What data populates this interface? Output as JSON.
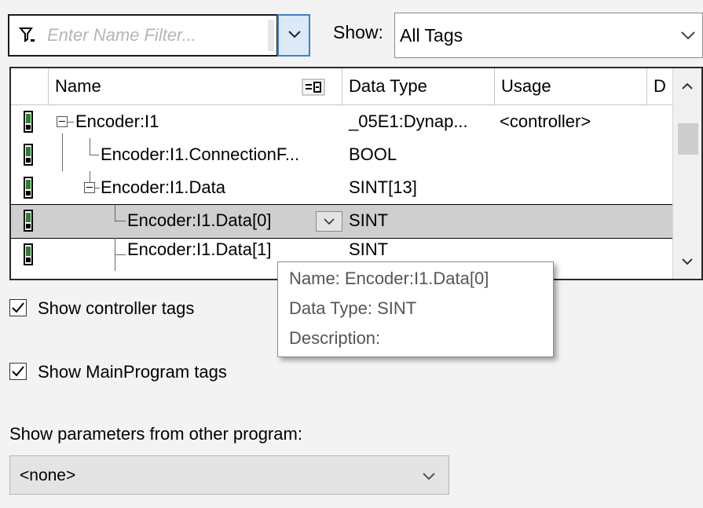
{
  "filter": {
    "placeholder": "Enter Name Filter...",
    "value": ""
  },
  "show": {
    "label": "Show:",
    "value": "All Tags"
  },
  "grid": {
    "columns": {
      "name": "Name",
      "data_type": "Data Type",
      "usage": "Usage",
      "description": "D"
    },
    "rows": [
      {
        "name": "Encoder:I1",
        "data_type": "_05E1:Dynap...",
        "usage": "<controller>"
      },
      {
        "name": "Encoder:I1.ConnectionF...",
        "data_type": "BOOL",
        "usage": ""
      },
      {
        "name": "Encoder:I1.Data",
        "data_type": "SINT[13]",
        "usage": ""
      },
      {
        "name": "Encoder:I1.Data[0]",
        "data_type": "SINT",
        "usage": "",
        "selected": true
      },
      {
        "name": "Encoder:I1.Data[1]",
        "data_type": "SINT",
        "usage": ""
      }
    ]
  },
  "tooltip": {
    "name": "Name: Encoder:I1.Data[0]",
    "data_type": "Data Type: SINT",
    "description": "Description:"
  },
  "options": {
    "show_controller_tags": {
      "label": "Show controller tags",
      "checked": true
    },
    "show_mainprogram_tags": {
      "label": "Show MainProgram tags",
      "checked": true
    }
  },
  "params": {
    "label": "Show parameters from other program:",
    "value": "<none>"
  },
  "colors": {
    "accent": "#3c7fd1",
    "selected_row": "#cfcfcf",
    "tag_icon": "#2e7d32"
  },
  "icons": [
    "filter-icon",
    "chevron-down-icon",
    "sort-icon",
    "tag-icon",
    "chevron-up-icon",
    "check-icon"
  ]
}
